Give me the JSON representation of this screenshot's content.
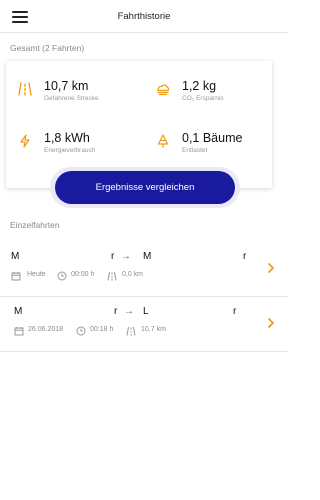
{
  "header": {
    "title": "Fahrthistorie"
  },
  "summary": {
    "heading": "Gesamt (2 Fahrten)",
    "stats": [
      {
        "value": "10,7 km",
        "label": "Gefahrene Strecke",
        "icon": "road-icon"
      },
      {
        "value": "1,2 kg",
        "label": "CO₂ Ersparnis",
        "icon": "cloud-icon"
      },
      {
        "value": "1,8 kWh",
        "label": "Energieverbrauch",
        "icon": "lightning-icon"
      },
      {
        "value": "0,1 Bäume",
        "label": "Entlastet",
        "icon": "tree-icon"
      }
    ],
    "compare_label": "Ergebnisse vergleichen"
  },
  "trips": {
    "heading": "Einzelfahrten",
    "items": [
      {
        "from_start": "M",
        "from_end": "r",
        "to_start": "M",
        "to_end": "r",
        "date": "Heute",
        "duration": "00:00 h",
        "distance": "0,0 km"
      },
      {
        "from_start": "M",
        "from_end": "r",
        "to_start": "L",
        "to_end": "r",
        "date": "26.06.2018",
        "duration": "00:18 h",
        "distance": "10,7 km"
      }
    ]
  },
  "colors": {
    "accent": "#f29a16",
    "primary_button": "#1a1a9e"
  }
}
